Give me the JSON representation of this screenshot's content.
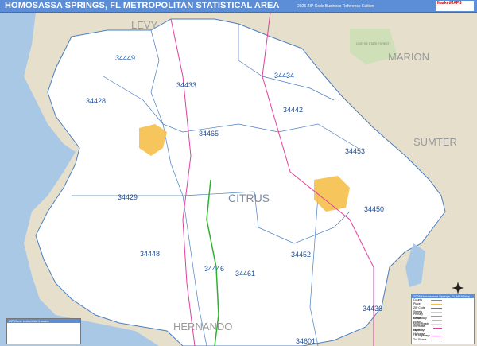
{
  "header": {
    "title": "HOMOSASSA SPRINGS, FL METROPOLITAN STATISTICAL AREA",
    "subtitle": "2026 ZIP Code Business Reference Edition",
    "logo_text": "MarketMAPS"
  },
  "map": {
    "colors": {
      "water": "#a9c8e6",
      "land": "#e6dfcc",
      "county": "#ffffff",
      "zip_boundary": "#4a7fc0",
      "city": "#f5c04a",
      "interstate": "#e040a0",
      "highway": "#30b030"
    },
    "county_label": "CITRUS",
    "neighbor_labels": [
      "LEVY",
      "MARION",
      "SUMTER",
      "HERNANDO"
    ],
    "forest_label": "GOETHE STATE FOREST",
    "zip_codes": [
      "34449",
      "34428",
      "34433",
      "34434",
      "34442",
      "34465",
      "34453",
      "34429",
      "34450",
      "34452",
      "34446",
      "34461",
      "34448",
      "34436",
      "34601"
    ]
  },
  "legend": {
    "title": "2026 Homosassa Springs, FL MSA Map",
    "items": [
      "County",
      "Place",
      "ZIP Code",
      "Streets",
      "Primary Roads",
      "Secondary Roads",
      "Minor Roads",
      "Interstate Highways",
      "State Highways",
      "US Highways",
      "Toll Roads"
    ],
    "cities_title": "Cities and Towns"
  },
  "index": {
    "title": "ZIP Code Index/Grid Locator"
  }
}
